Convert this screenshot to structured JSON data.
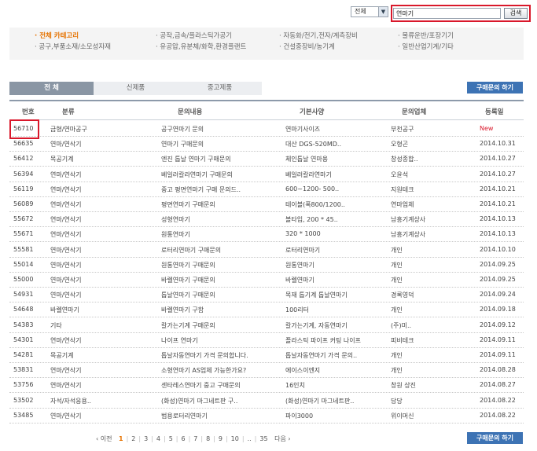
{
  "search": {
    "scope": "전체",
    "query": "연마기",
    "button": "검색"
  },
  "categories": [
    {
      "label": "· 전체 카테고리",
      "active": true
    },
    {
      "label": "· 공작,금속/플라스틱가공기"
    },
    {
      "label": "· 자동화/전기,전자/계측장비"
    },
    {
      "label": "· 물류운반/포장기기"
    },
    {
      "label": "· 공구,부품소재/소모성자재"
    },
    {
      "label": "· 유공압,유분체/화학,환경플랜트"
    },
    {
      "label": "· 건설중장비/농기계"
    },
    {
      "label": "· 일반산업기계/기타"
    }
  ],
  "tabs": [
    {
      "label": "전 체",
      "active": true
    },
    {
      "label": "신제품"
    },
    {
      "label": "중고제품"
    }
  ],
  "buy_button": "구매문의 하기",
  "table": {
    "headers": [
      "번호",
      "분류",
      "문의내용",
      "기본사양",
      "문의업체",
      "등록일"
    ],
    "rows": [
      [
        "56710",
        "금형/연마공구",
        "공구연마기 문의",
        "연마기사이즈",
        "부천공구",
        "New"
      ],
      [
        "56635",
        "연마/연삭기",
        "연마기 구매문의",
        "대산 DGS-520MD..",
        "오형곤",
        "2014.10.31"
      ],
      [
        "56412",
        "목공기계",
        "엔진 톱날 연마기 구매문의",
        "체인톱날 연마용",
        "창성종합..",
        "2014.10.27"
      ],
      [
        "56394",
        "연마/연삭기",
        "베일러칼라연마기 구매문의",
        "베일러칼라연마기",
        "오윤석",
        "2014.10.27"
      ],
      [
        "56119",
        "연마/연삭기",
        "중고 평면연마기 구매 문의드..",
        "600~1200- 500..",
        "지원테크",
        "2014.10.21"
      ],
      [
        "56089",
        "연마/연삭기",
        "평면연마기 구매문의",
        "테이블(폭800/1200..",
        "연마업체",
        "2014.10.21"
      ],
      [
        "55672",
        "연마/연삭기",
        "성형연마기",
        "볼타입, 200 * 45..",
        "남흥기계상사",
        "2014.10.13"
      ],
      [
        "55671",
        "연마/연삭기",
        "원통연마기",
        "320 * 1000",
        "남흥기계상사",
        "2014.10.13"
      ],
      [
        "55581",
        "연마/연삭기",
        "로터리연마기 구매문의",
        "로터리연마기",
        "개인",
        "2014.10.10"
      ],
      [
        "55014",
        "연마/연삭기",
        "원통연마기 구매문의",
        "원통연마기",
        "개인",
        "2014.09.25"
      ],
      [
        "55000",
        "연마/연삭기",
        "바렐연마기 구매문의",
        "바렐연마기",
        "개인",
        "2014.09.25"
      ],
      [
        "54931",
        "연마/연삭기",
        "톱날연마기 구매문의",
        "목재 톱기계 톱날연마기",
        "경록영덕",
        "2014.09.24"
      ],
      [
        "54648",
        "바렐연마기",
        "바렐연마기 구함",
        "100리터",
        "개인",
        "2014.09.18"
      ],
      [
        "54383",
        "기타",
        "칼가는기계 구매문의",
        "칼가는기계, 자동연마기",
        "(주)미..",
        "2014.09.12"
      ],
      [
        "54301",
        "연마/연삭기",
        "나이프 연마기",
        "플라스틱 파이프 커팅 나이프",
        "피비테크",
        "2014.09.11"
      ],
      [
        "54281",
        "목공기계",
        "톱날자동연마기 가격 문의합니다.",
        "톱날자동연마기 가격 문의..",
        "개인",
        "2014.09.11"
      ],
      [
        "53831",
        "연마/연삭기",
        "소형연마기 AS업체 가능한가요?",
        "에이스이엔지",
        "개인",
        "2014.08.28"
      ],
      [
        "53756",
        "연마/연삭기",
        "센타레스연마기 중고 구매문의",
        "16인치",
        "창원 상진",
        "2014.08.27"
      ],
      [
        "53502",
        "자석/자석응용..",
        "(화성)연마기 마그네트판 구..",
        "(화성)연마기 마그네트판..",
        "담당",
        "2014.08.22"
      ],
      [
        "53485",
        "연마/연삭기",
        "범용로터리연마기",
        "파이3000",
        "위이머신",
        "2014.08.22"
      ]
    ]
  },
  "pager": {
    "prev": "‹ 이전",
    "pages": [
      "1",
      "2",
      "3",
      "4",
      "5",
      "6",
      "7",
      "8",
      "9",
      "10",
      "..",
      "35"
    ],
    "current": "1",
    "next": "다음 ›"
  }
}
